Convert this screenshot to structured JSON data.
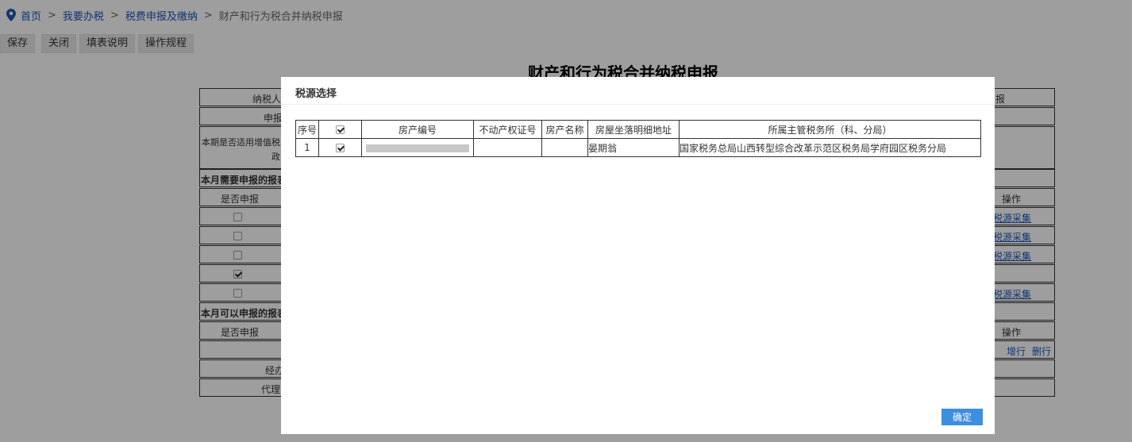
{
  "breadcrumb": {
    "items": [
      "首页",
      "我要办税",
      "税费申报及缴纳"
    ],
    "separator": ">",
    "current": "财产和行为税合并纳税申报"
  },
  "toolbar": {
    "save": "保存",
    "close": "关闭",
    "fill_guide": "填表说明",
    "procedure": "操作规程"
  },
  "page_title": "财产和行为税合并纳税申报",
  "background_form": {
    "row1_left": "纳税人",
    "row1_right": "报",
    "row2_left": "申报",
    "row3_left_line1": "本期是否适用增值税",
    "row3_left_line2": "政",
    "section1": "本月需要申报的报表",
    "col_declare": "是否申报",
    "col_action": "操作",
    "rows1": [
      {
        "checked": false,
        "action": "税源采集"
      },
      {
        "checked": false,
        "action": "税源采集"
      },
      {
        "checked": false,
        "action": "税源采集"
      },
      {
        "checked": true,
        "action": ""
      },
      {
        "checked": false,
        "action": "税源采集"
      }
    ],
    "section2": "本月可以申报的报表",
    "add_row": "增行",
    "delete_row": "删行",
    "handler": "经办",
    "agent": "代理"
  },
  "modal": {
    "title": "税源选择",
    "table": {
      "headers": [
        "序号",
        "",
        "房产编号",
        "不动产权证号",
        "房产名称",
        "房屋坐落明细地址",
        "所属主管税务所（科、分局）"
      ],
      "rows": [
        {
          "index": "1",
          "checked": true,
          "property_no": "",
          "cert_no": "",
          "property_name": "",
          "address": "晏期翁",
          "tax_office": "国家税务总局山西转型综合改革示范区税务局学府园区税务分局"
        }
      ]
    },
    "confirm_label": "确定"
  },
  "colors": {
    "link": "#1a56b8",
    "confirm_button": "#3e8ee0",
    "overlay": "rgba(0,0,0,0.38)"
  }
}
